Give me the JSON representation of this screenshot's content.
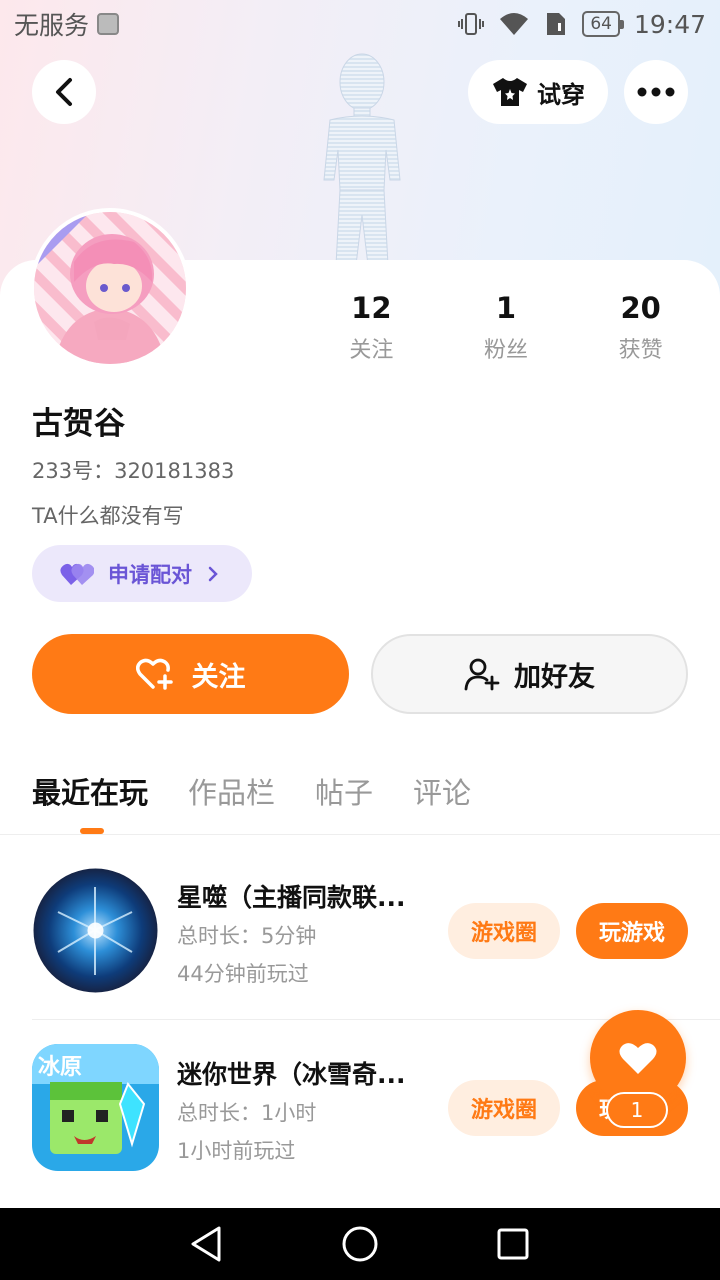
{
  "status_bar": {
    "carrier": "无服务",
    "battery": "64",
    "time": "19:47"
  },
  "header": {
    "try_on_label": "试穿"
  },
  "profile": {
    "stats": [
      {
        "value": "12",
        "label": "关注"
      },
      {
        "value": "1",
        "label": "粉丝"
      },
      {
        "value": "20",
        "label": "获赞"
      }
    ],
    "name": "古贺谷",
    "id_line": "233号：320181383",
    "bio": "TA什么都没有写",
    "match_label": "申请配对"
  },
  "actions": {
    "follow_label": "关注",
    "add_friend_label": "加好友"
  },
  "tabs": [
    "最近在玩",
    "作品栏",
    "帖子",
    "评论"
  ],
  "games": [
    {
      "title": "星噬（主播同款联...",
      "duration": "总时长：5分钟",
      "last_played": "44分钟前玩过",
      "circle_label": "游戏圈",
      "play_label": "玩游戏"
    },
    {
      "title": "迷你世界（冰雪奇...",
      "duration": "总时长：1小时",
      "last_played": "1小时前玩过",
      "circle_label": "游戏圈",
      "play_label": "玩游戏",
      "icon_text": "冰原"
    }
  ],
  "like_fab": {
    "count": "1"
  },
  "colors": {
    "accent": "#ff7a15",
    "match_purple": "#6a55d6"
  }
}
